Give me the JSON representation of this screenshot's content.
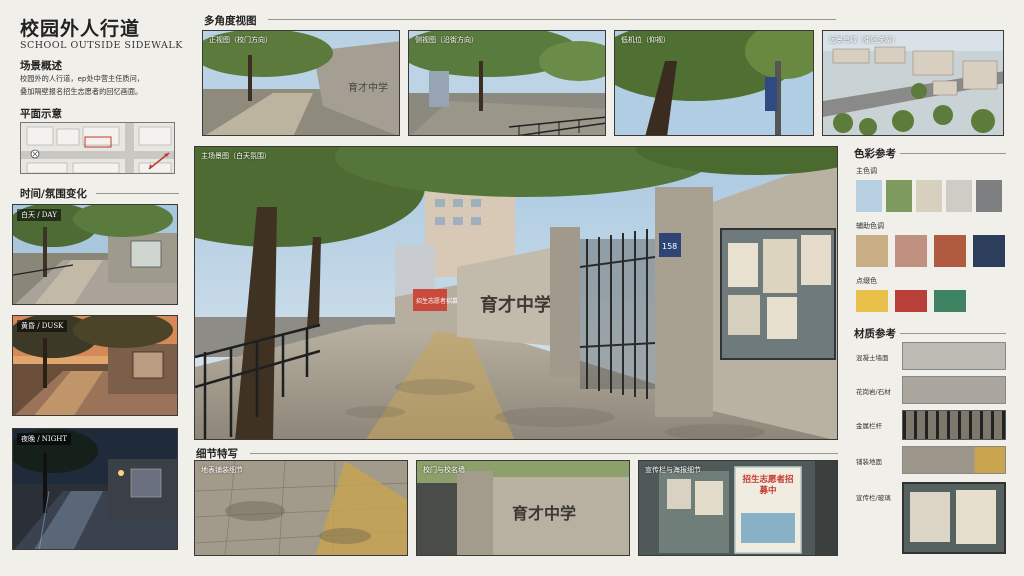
{
  "header": {
    "title": "校园外人行道",
    "subtitle": "SCHOOL OUTSIDE SIDEWALK"
  },
  "overview": {
    "heading": "场景概述",
    "lines": [
      "校园外的人行道，ep处中营主任质问，",
      "叠加隔壁报名招生志愿者的回忆画面。"
    ]
  },
  "plan": {
    "heading": "平面示意"
  },
  "timeofday": {
    "heading": "时间/氛围变化",
    "items": [
      {
        "label": "白天 / DAY"
      },
      {
        "label": "黄昏 / DUSK"
      },
      {
        "label": "夜晚 / NIGHT"
      }
    ]
  },
  "views": {
    "heading": "多角度视图",
    "items": [
      {
        "label": "正视图（校门方向）"
      },
      {
        "label": "侧视图（沿街方向）"
      },
      {
        "label": "低机位（仰视）"
      },
      {
        "label": "远景鸟瞰（街区关系）"
      }
    ]
  },
  "main": {
    "label": "主场景图（白天氛围）",
    "plate": "158",
    "wall_text": "育才中学",
    "banner_text": "招生志愿者招募中"
  },
  "details": {
    "heading": "细节特写",
    "items": [
      {
        "label": "地表铺装细节"
      },
      {
        "label": "校门与校名墙",
        "wall_text": "育才中学"
      },
      {
        "label": "宣传栏与海报细节",
        "poster_text": "招生志愿者招募中"
      }
    ]
  },
  "colors": {
    "heading": "色彩参考",
    "groups": [
      {
        "label": "主色调",
        "swatches": [
          "#b7d0e2",
          "#7f9a5e",
          "#d8d0bf",
          "#cfccc5",
          "#7d7f80"
        ]
      },
      {
        "label": "辅助色调",
        "swatches": [
          "#c9ae85",
          "#c09080",
          "#b05a40",
          "#2c3e5c"
        ]
      },
      {
        "label": "点缀色",
        "swatches": [
          "#e8c04a",
          "#b84038",
          "#3e8462"
        ]
      }
    ]
  },
  "materials": {
    "heading": "材质参考",
    "items": [
      {
        "label": "混凝土墙面"
      },
      {
        "label": "花岗岩/石材"
      },
      {
        "label": "金属栏杆"
      },
      {
        "label": "铺装地面"
      },
      {
        "label": "宣传栏/玻璃"
      }
    ]
  }
}
